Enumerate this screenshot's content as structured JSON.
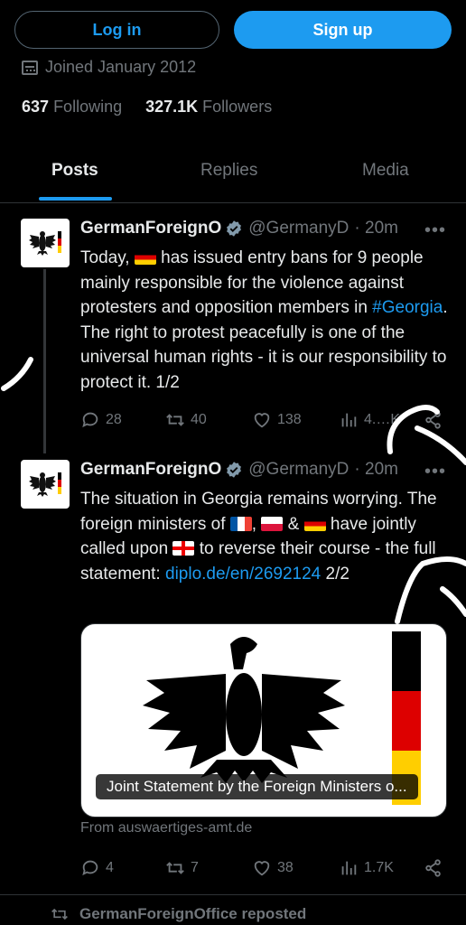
{
  "auth": {
    "login_label": "Log in",
    "signup_label": "Sign up"
  },
  "profile": {
    "joined": "Joined January 2012",
    "following_count": "637",
    "following_label": "Following",
    "followers_count": "327.1K",
    "followers_label": "Followers"
  },
  "tabs": [
    {
      "label": "Posts",
      "active": true
    },
    {
      "label": "Replies",
      "active": false
    },
    {
      "label": "Media",
      "active": false
    }
  ],
  "posts": [
    {
      "name": "GermanForeignO",
      "handle": "@GermanyD",
      "time": "· 20m",
      "text": {
        "a": "Today, ",
        "b": " has issued entry bans for 9 people mainly responsible for the violence against protesters and opposition members in ",
        "hashtag": "#Georgia",
        "c": ". The right to protest peacefully is one of the universal human rights - it is our responsibility to protect it. 1/2"
      },
      "replies": "28",
      "reposts": "40",
      "likes": "138",
      "views": "4.…K"
    },
    {
      "name": "GermanForeignO",
      "handle": "@GermanyD",
      "time": "· 20m",
      "text": {
        "a": "The situation in Georgia remains worrying. The foreign ministers of ",
        "b": ", ",
        "c": " & ",
        "d": " have jointly called upon ",
        "e": " to reverse their course - the full statement: ",
        "link": "diplo.de/en/2692124",
        "f": " 2/2"
      },
      "card_caption": "Joint Statement by the Foreign Ministers o...",
      "card_from": "From auswaertiges-amt.de",
      "replies": "4",
      "reposts": "7",
      "likes": "38",
      "views": "1.7K"
    }
  ],
  "repost_notice": "GermanForeignOffice reposted",
  "colors": {
    "accent": "#1d9bf0",
    "background": "#000000",
    "muted": "#71767b",
    "text": "#e7e9ea"
  },
  "icons": [
    "calendar-icon",
    "verified-icon",
    "more-icon",
    "reply-icon",
    "repost-icon",
    "like-icon",
    "views-icon",
    "share-icon",
    "eagle-icon"
  ]
}
